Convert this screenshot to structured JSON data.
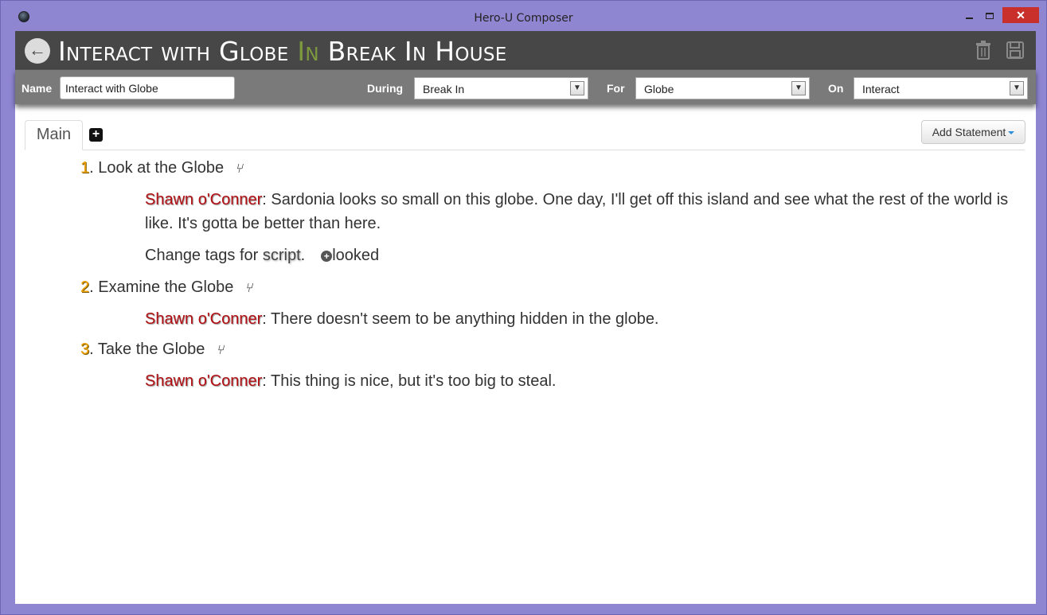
{
  "window": {
    "title": "Hero-U Composer",
    "minimize": "",
    "maximize": "",
    "close": "✕"
  },
  "header": {
    "title_part1": "Interact with Globe ",
    "title_in": "In",
    "title_part2": " Break In House",
    "back_icon": "arrow-left-icon",
    "trash_icon": "trash-icon",
    "save_icon": "save-icon"
  },
  "filters": {
    "name_label": "Name",
    "name_value": "Interact with Globe",
    "during_label": "During",
    "during_value": "Break In",
    "for_label": "For",
    "for_value": "Globe",
    "on_label": "On",
    "on_value": "Interact"
  },
  "tabs": {
    "main_label": "Main",
    "add_label": "+"
  },
  "add_statement_label": "Add Statement",
  "steps": [
    {
      "num": "1",
      "sep": ". ",
      "title": "Look at the Globe",
      "dialogue": {
        "speaker": "Shawn o'Conner",
        "text": ": Sardonia looks so small on this globe. One day, I'll get off this island and see what the rest of the world is like. It's gotta be better than here."
      },
      "tags": {
        "prefix": "Change tags for ",
        "target": "script",
        "suffix": ".",
        "tag": "looked"
      }
    },
    {
      "num": "2",
      "sep": ". ",
      "title": "Examine the Globe",
      "dialogue": {
        "speaker": "Shawn o'Conner",
        "text": ": There doesn't seem to be anything hidden in the globe."
      }
    },
    {
      "num": "3",
      "sep": ". ",
      "title": "Take the Globe",
      "dialogue": {
        "speaker": "Shawn o'Conner",
        "text": ": This thing is nice, but it's too big to steal."
      }
    }
  ],
  "colors": {
    "window_frame": "#8f86d2",
    "header_bg": "#474747",
    "filter_bg": "#7a7a7a",
    "speaker": "#b00e12",
    "step_number": "#f0a000",
    "title_in": "#7e9a3e"
  }
}
